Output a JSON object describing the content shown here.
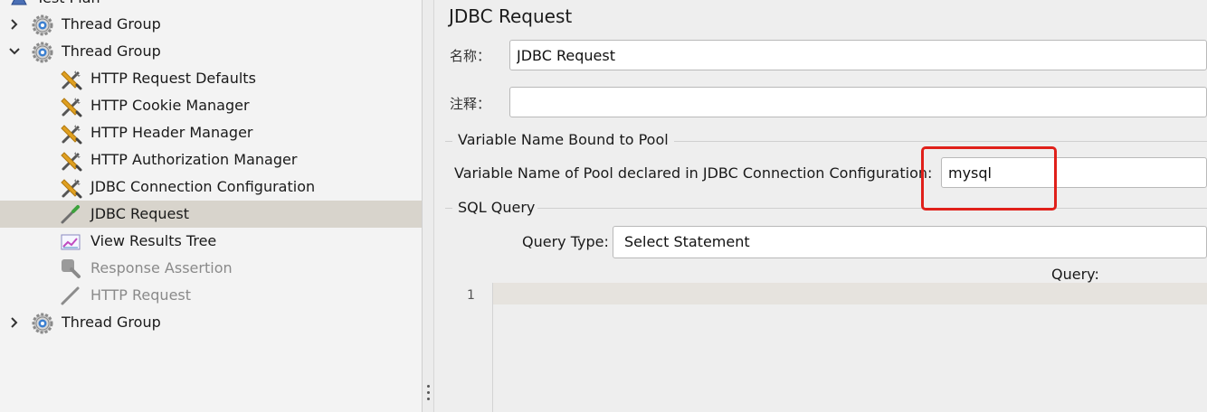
{
  "tree": {
    "root_label": "Test Plan",
    "items": [
      {
        "label": "Thread Group",
        "icon": "gear-icon"
      },
      {
        "label": "Thread Group",
        "icon": "gear-icon"
      },
      {
        "label": "HTTP Request Defaults",
        "icon": "wrench-screwdriver-icon"
      },
      {
        "label": "HTTP Cookie Manager",
        "icon": "wrench-screwdriver-icon"
      },
      {
        "label": "HTTP Header Manager",
        "icon": "wrench-screwdriver-icon"
      },
      {
        "label": "HTTP Authorization Manager",
        "icon": "wrench-screwdriver-icon"
      },
      {
        "label": "JDBC Connection Configuration",
        "icon": "wrench-screwdriver-icon"
      },
      {
        "label": "JDBC Request",
        "icon": "pipette-icon"
      },
      {
        "label": "View Results Tree",
        "icon": "graph-icon"
      },
      {
        "label": "Response Assertion",
        "icon": "magnifier-icon"
      },
      {
        "label": "HTTP Request",
        "icon": "pipette-icon"
      },
      {
        "label": "Thread Group",
        "icon": "gear-icon"
      }
    ]
  },
  "panel": {
    "title": "JDBC Request",
    "name_label": "名称：",
    "name_value": "JDBC Request",
    "comment_label": "注释：",
    "comment_value": "",
    "pool_section": "Variable Name Bound to Pool",
    "pool_label": "Variable Name of Pool declared in JDBC Connection Configuration:",
    "pool_value": "mysql",
    "sql_section": "SQL Query",
    "query_type_label": "Query Type:",
    "query_type_value": "Select Statement",
    "query_label": "Query:",
    "line_number": "1"
  },
  "colors": {
    "highlight": "#e0201a",
    "selected_row": "#d8d4cc"
  }
}
